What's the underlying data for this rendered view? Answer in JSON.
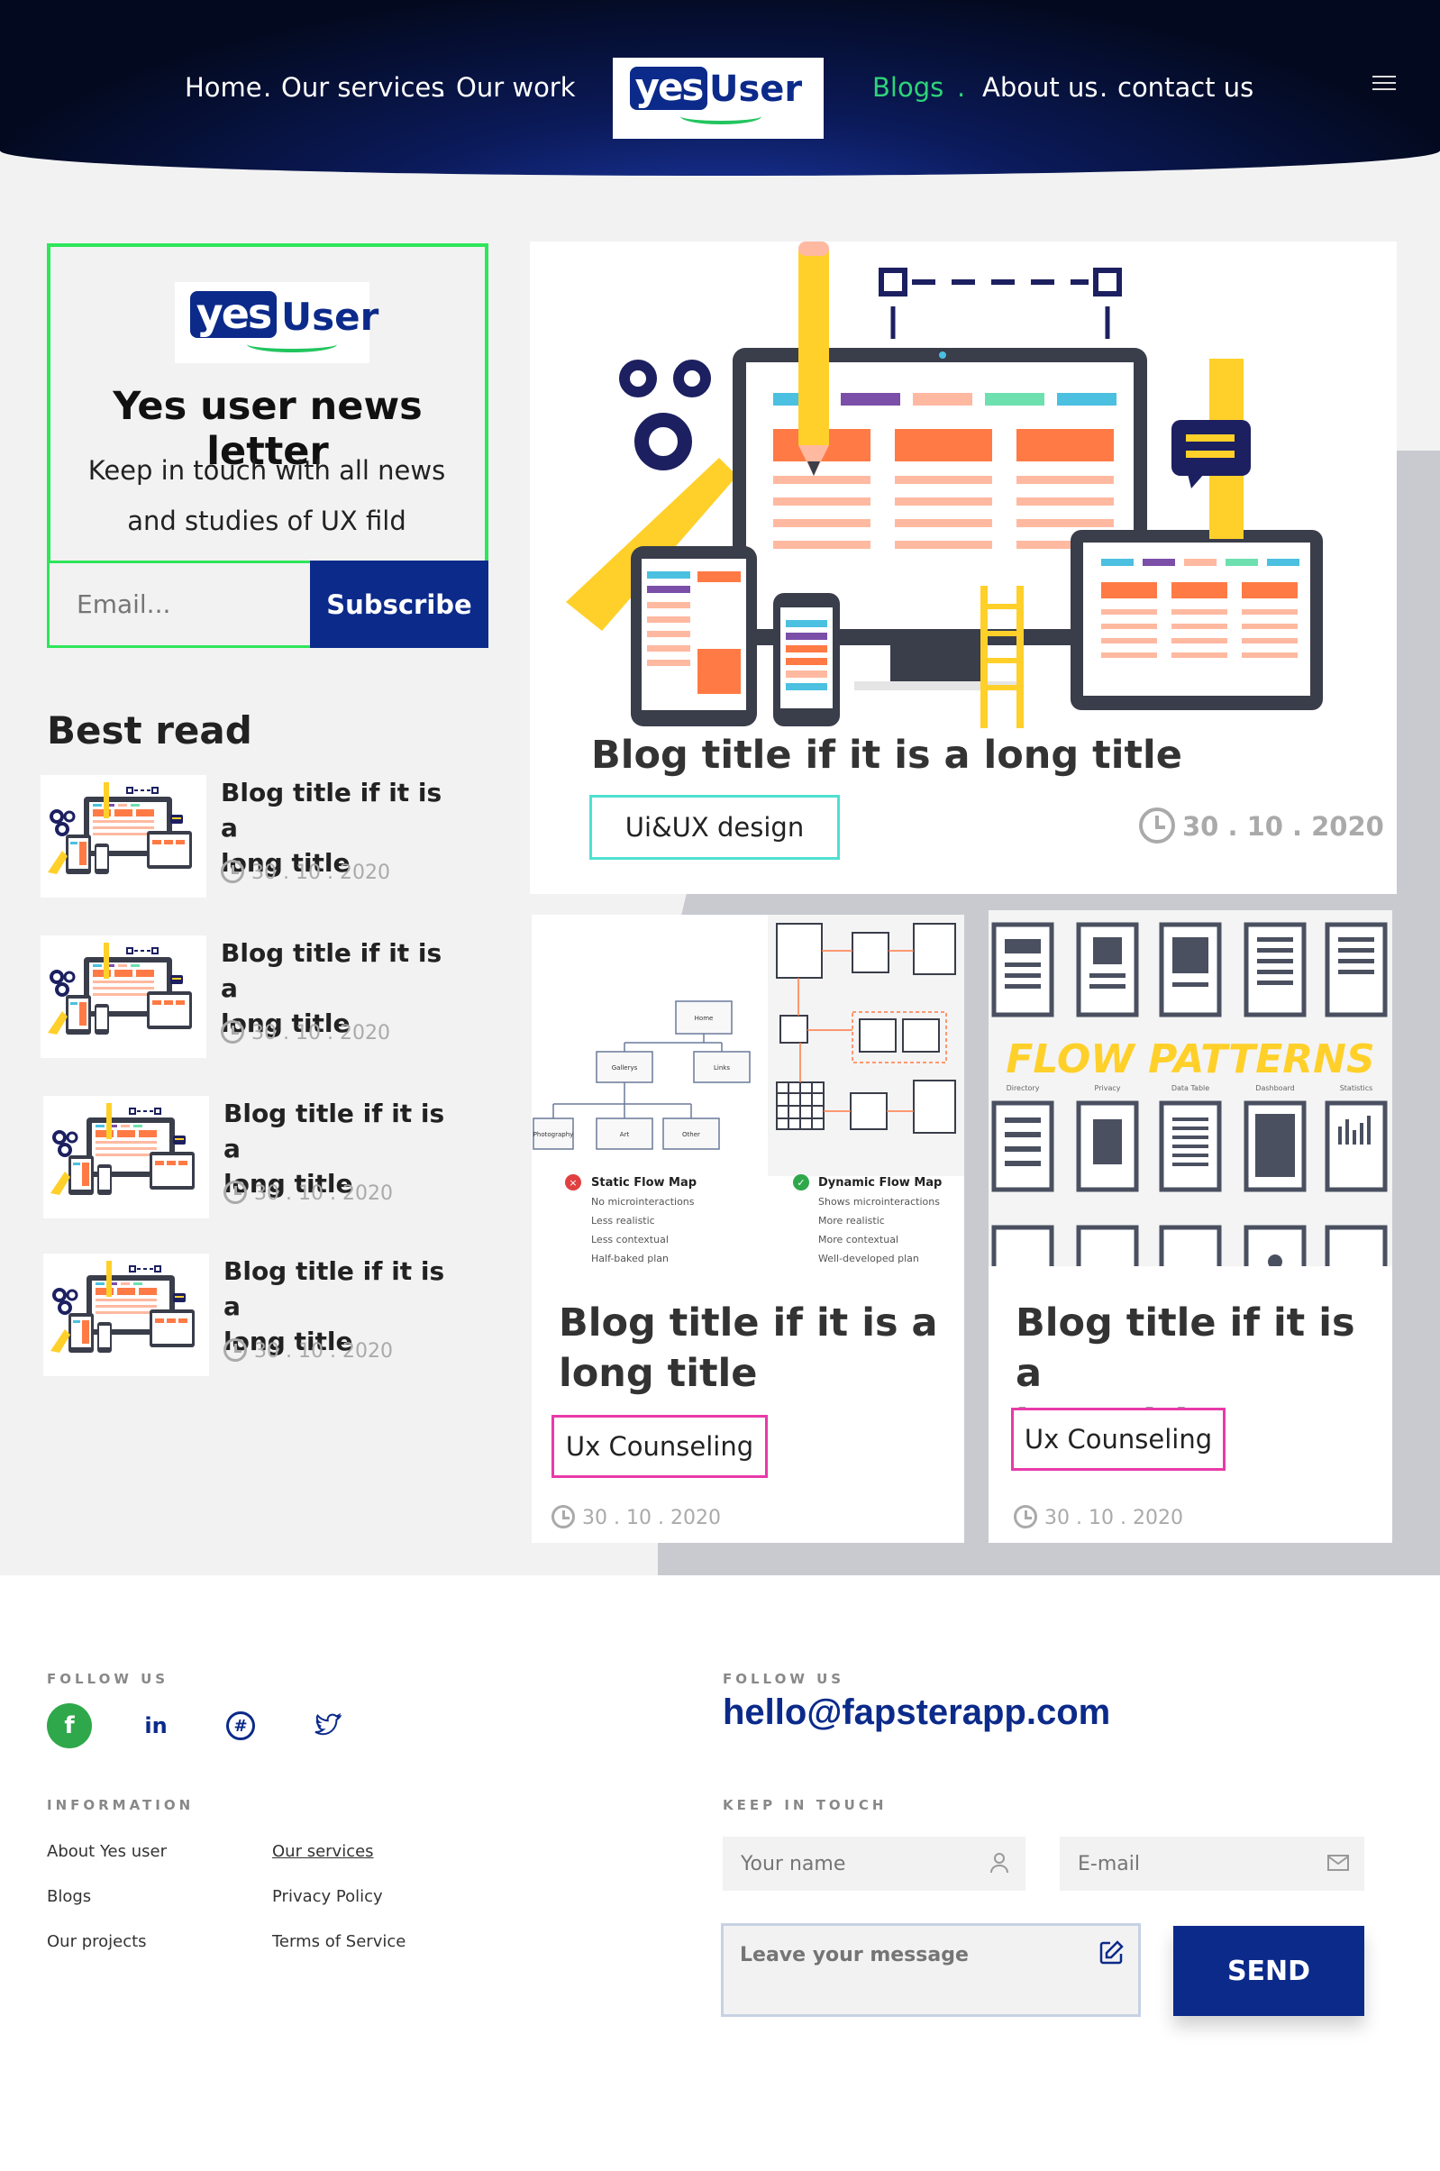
{
  "nav": {
    "home": "Home",
    "services": "Our services",
    "work": "Our work",
    "blogs": "Blogs",
    "about": "About us",
    "contact": "contact us",
    "separator": "."
  },
  "logo": {
    "yes": "yes",
    "user": "User"
  },
  "newsletter": {
    "title": "Yes user news letter",
    "text_line1": "Keep in touch with all news",
    "text_line2": "and studies of UX fild",
    "email_placeholder": "Email...",
    "subscribe": "Subscribe"
  },
  "best_read": {
    "title": "Best read",
    "items": [
      {
        "title_line1": "Blog title if it is a",
        "title_line2": "long title",
        "date": "30 . 10 . 2020"
      },
      {
        "title_line1": "Blog title if it is a",
        "title_line2": "long title",
        "date": "30 . 10 . 2020"
      },
      {
        "title_line1": "Blog title if it is a",
        "title_line2": "long title",
        "date": "30 . 10 . 2020"
      },
      {
        "title_line1": "Blog title if it is a",
        "title_line2": "long title",
        "date": "30 . 10 . 2020"
      }
    ]
  },
  "featured": {
    "title": "Blog title if it is a long title",
    "tag": "Ui&UX design",
    "date": "30 . 10 . 2020"
  },
  "cards": [
    {
      "title_line1": "Blog title if it is a",
      "title_line2": "long title",
      "tag": "Ux Counseling",
      "date": "30 . 10 . 2020",
      "image": {
        "static_label": "Static Flow Map",
        "static_points": [
          "No microinteractions",
          "Less realistic",
          "Less contextual",
          "Half-baked plan"
        ],
        "dynamic_label": "Dynamic Flow Map",
        "dynamic_points": [
          "Shows microinteractions",
          "More realistic",
          "More contextual",
          "Well-developed plan"
        ],
        "nodes": [
          "Home",
          "Gallerys",
          "Links",
          "Photography",
          "Art",
          "Other"
        ]
      }
    },
    {
      "title_line1": "Blog title if it is a",
      "title_line2": "long title",
      "tag": "Ux Counseling",
      "date": "30 . 10 . 2020",
      "image": {
        "heading": "FLOW PATTERNS",
        "labels": [
          "Directory",
          "Privacy",
          "Data Table",
          "Dashboard",
          "Statistics"
        ]
      }
    }
  ],
  "footer": {
    "follow_title": "FOLLOW US",
    "social": [
      "facebook-icon",
      "linkedin-icon",
      "hashtag-icon",
      "twitter-icon"
    ],
    "info_title": "INFORMATION",
    "links_col1": [
      "About Yes user",
      "Blogs",
      "Our projects"
    ],
    "links_col2": [
      "Our services",
      "Privacy Policy",
      "Terms of Service"
    ],
    "follow_title_2": "FOLLOW US",
    "email": "hello@fapsterapp.com",
    "touch_title": "KEEP IN TOUCH",
    "name_placeholder": "Your name",
    "email_placeholder": "E-mail",
    "message_placeholder": "Leave your message",
    "send": "SEND"
  },
  "colors": {
    "brand_blue": "#0b2a8a",
    "accent_green": "#2ed37a",
    "newsletter_border": "#2ee65a",
    "tag_cyan": "#4ee0d0",
    "tag_pink": "#e83aa8"
  }
}
